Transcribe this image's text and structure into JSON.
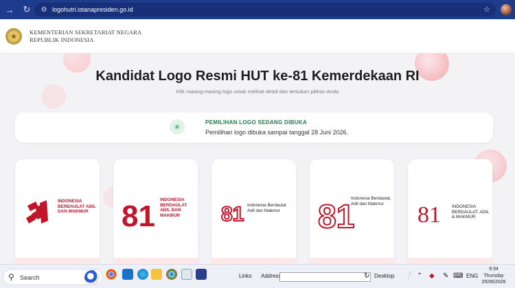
{
  "browser": {
    "url": "logohutri.istanapresiden.go.id",
    "back_icon": "arrow-right-icon",
    "reload_icon": "reload-icon"
  },
  "header": {
    "org_line1": "KEMENTERIAN SEKRETARIAT NEGARA",
    "org_line2": "REPUBLIK INDONESIA"
  },
  "main": {
    "title": "Kandidat Logo Resmi HUT ke-81 Kemerdekaan RI",
    "subtitle": "Klik masing-masing logo untuk melihat detail dan tentukan pilihan Anda",
    "notice": {
      "title": "PEMILIHAN LOGO SEDANG DIBUKA",
      "text": "Pemilihan logo dibuka sampai tanggal 28 Juni 2026."
    },
    "logos": [
      {
        "number": "81",
        "label": "INDONESIA BERDAULAT ADIL DAN MAKMUR"
      },
      {
        "number": "81",
        "label": "INDONESIA BERDAULAT ADIL DAN MAKMUR"
      },
      {
        "number": "81",
        "label": "Indonesia Berdaulat Adil dan Makmur"
      },
      {
        "number": "81",
        "label": "Indonesia Berdaulat, Adil dan Makmur"
      },
      {
        "number": "81",
        "label": "INDONESIA BERDAULAT, ADIL & MAKMUR"
      }
    ]
  },
  "taskbar": {
    "search_label": "Search",
    "links_label": "Links",
    "address_label": "Address",
    "desktop_label": "Desktop",
    "language": "ENG",
    "time": "9:34",
    "day": "Thursday",
    "date": "25/06/2026"
  },
  "colors": {
    "brand_red": "#c0152a",
    "browser_blue": "#1f3b8c",
    "notice_green": "#1f7a4c"
  }
}
